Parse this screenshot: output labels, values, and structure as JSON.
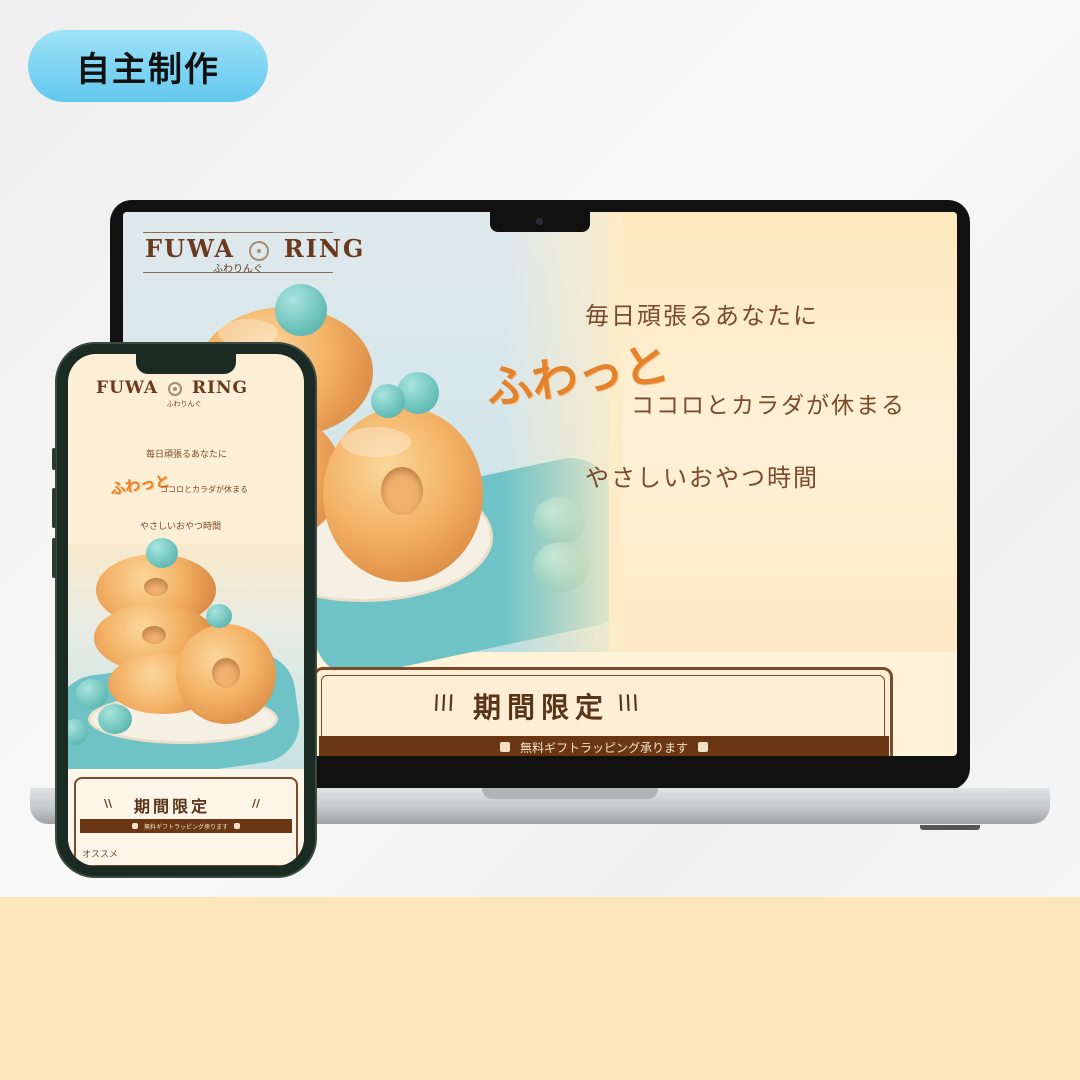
{
  "badge": {
    "label": "自主制作"
  },
  "site": {
    "brand_left": "FUWA",
    "brand_right": "RING",
    "brand_sub": "ふわりんぐ",
    "catch_line1": "毎日頑張るあなたに",
    "catch_fuwatto": "ふわっと",
    "catch_line2": "ココロとカラダが休まる",
    "catch_line3": "やさしいおやつ時間",
    "limited_title": "期間限定",
    "limited_bar": "無料ギフトラッピング承ります",
    "phone_next_heading": "オススメ"
  },
  "colors": {
    "badge_blue": "#62c8ee",
    "brown": "#6b3a1e",
    "accent_orange": "#e5822c",
    "bottom_band": "#fde6b9"
  }
}
